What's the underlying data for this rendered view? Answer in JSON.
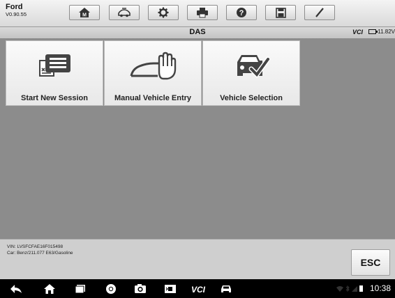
{
  "app": {
    "make": "Ford",
    "version": "V0.90.55"
  },
  "toolbar": {
    "buttons": [
      {
        "name": "home-button",
        "icon": "home-icon"
      },
      {
        "name": "vehicle-swap-button",
        "icon": "car-swap-icon"
      },
      {
        "name": "settings-button",
        "icon": "gear-icon"
      },
      {
        "name": "print-button",
        "icon": "printer-icon"
      },
      {
        "name": "help-button",
        "icon": "help-icon"
      },
      {
        "name": "save-button",
        "icon": "save-icon"
      },
      {
        "name": "edit-button",
        "icon": "pencil-icon"
      }
    ]
  },
  "titlebar": {
    "title": "DAS",
    "vci_label": "VCI",
    "battery": "11.82V"
  },
  "tiles": [
    {
      "label": "Start New Session",
      "icon": "new-session-icon"
    },
    {
      "label": "Manual Vehicle Entry",
      "icon": "manual-entry-icon"
    },
    {
      "label": "Vehicle Selection",
      "icon": "vehicle-selection-icon"
    }
  ],
  "info": {
    "vin": "VIN: LVSFCFAE16F015498",
    "car": "Car: Benz/211.077 E63/Gasoline",
    "esc_label": "ESC"
  },
  "navbar": {
    "items": [
      "back-icon",
      "home-icon",
      "recents-icon",
      "chrome-icon",
      "camera-icon",
      "screen-capture-icon",
      "vci-icon",
      "car-icon"
    ],
    "vci_text": "VCI",
    "clock": "10:38"
  }
}
